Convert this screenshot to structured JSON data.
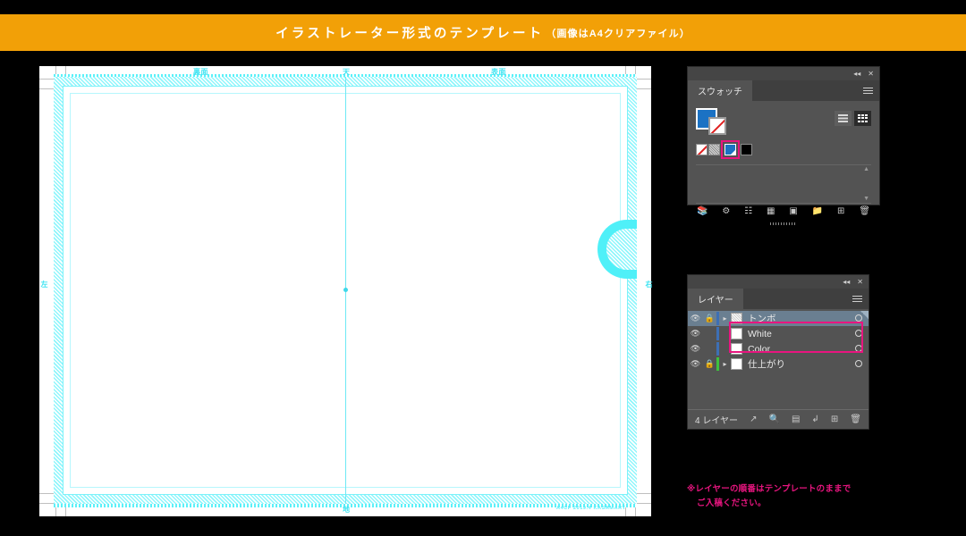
{
  "banner": {
    "title": "イラストレーター形式のテンプレート",
    "subtitle": "（画像はA4クリアファイル）",
    "bg_color": "#f2a007",
    "text_color": "#ffffff"
  },
  "artboard": {
    "labels": {
      "top_left": "裏面",
      "top_center": "天",
      "top_right": "表面",
      "left_edge": "左",
      "right_edge": "右",
      "bottom_center": "地"
    },
    "footer_credit": "A4CF 2019.4 KASAMART",
    "guide_color": "#4ff0f8",
    "paper_color": "#ffffff"
  },
  "swatches_panel": {
    "tab_label": "スウォッチ",
    "menu_icon": "hamburger-menu-icon",
    "collapse_icon": "collapse-panel-icon",
    "close_icon": "close-panel-icon",
    "fill_color": "#1b72c4",
    "stroke_value": "none",
    "view_modes": [
      {
        "name": "list-view",
        "selected": false
      },
      {
        "name": "grid-view",
        "selected": true
      }
    ],
    "swatches": [
      {
        "name": "none-swatch",
        "color": "#ffffff",
        "selected": false
      },
      {
        "name": "registration-swatch",
        "color": "#8a8a8a",
        "selected": false
      },
      {
        "name": "blue-swatch",
        "color": "#1b72c4",
        "selected": true
      },
      {
        "name": "black-swatch",
        "color": "#000000",
        "selected": false
      }
    ],
    "selection_highlight_color": "#e8157f",
    "footer_icons": [
      "swatch-libraries-icon",
      "color-group-icon",
      "show-swatch-kinds-icon",
      "swatch-options-icon",
      "new-color-group-icon",
      "new-swatch-icon",
      "delete-swatch-icon"
    ]
  },
  "layers_panel": {
    "tab_label": "レイヤー",
    "menu_icon": "hamburger-menu-icon",
    "collapse_icon": "collapse-panel-icon",
    "close_icon": "close-panel-icon",
    "rows": [
      {
        "name": "トンボ",
        "visible": true,
        "locked": true,
        "expandable": true,
        "selected": true,
        "color": "#3d6fb5",
        "highlighted": false
      },
      {
        "name": "White",
        "visible": true,
        "locked": false,
        "expandable": false,
        "selected": false,
        "color": "#3d6fb5",
        "highlighted": true
      },
      {
        "name": "Color",
        "visible": true,
        "locked": false,
        "expandable": false,
        "selected": false,
        "color": "#3d6fb5",
        "highlighted": true
      },
      {
        "name": "仕上がり",
        "visible": true,
        "locked": true,
        "expandable": true,
        "selected": false,
        "color": "#3ec13e",
        "highlighted": false
      }
    ],
    "layer_count_label": "4 レイヤー",
    "highlight_color": "#e8157f",
    "footer_icons": [
      "collect-for-export-icon",
      "locate-object-icon",
      "make-clipping-mask-icon",
      "create-new-sublayer-icon",
      "create-new-layer-icon",
      "delete-layer-icon"
    ]
  },
  "note": {
    "line1": "※レイヤーの順番はテンプレートのままで",
    "line2": "ご入稿ください。",
    "color": "#e8157f"
  }
}
